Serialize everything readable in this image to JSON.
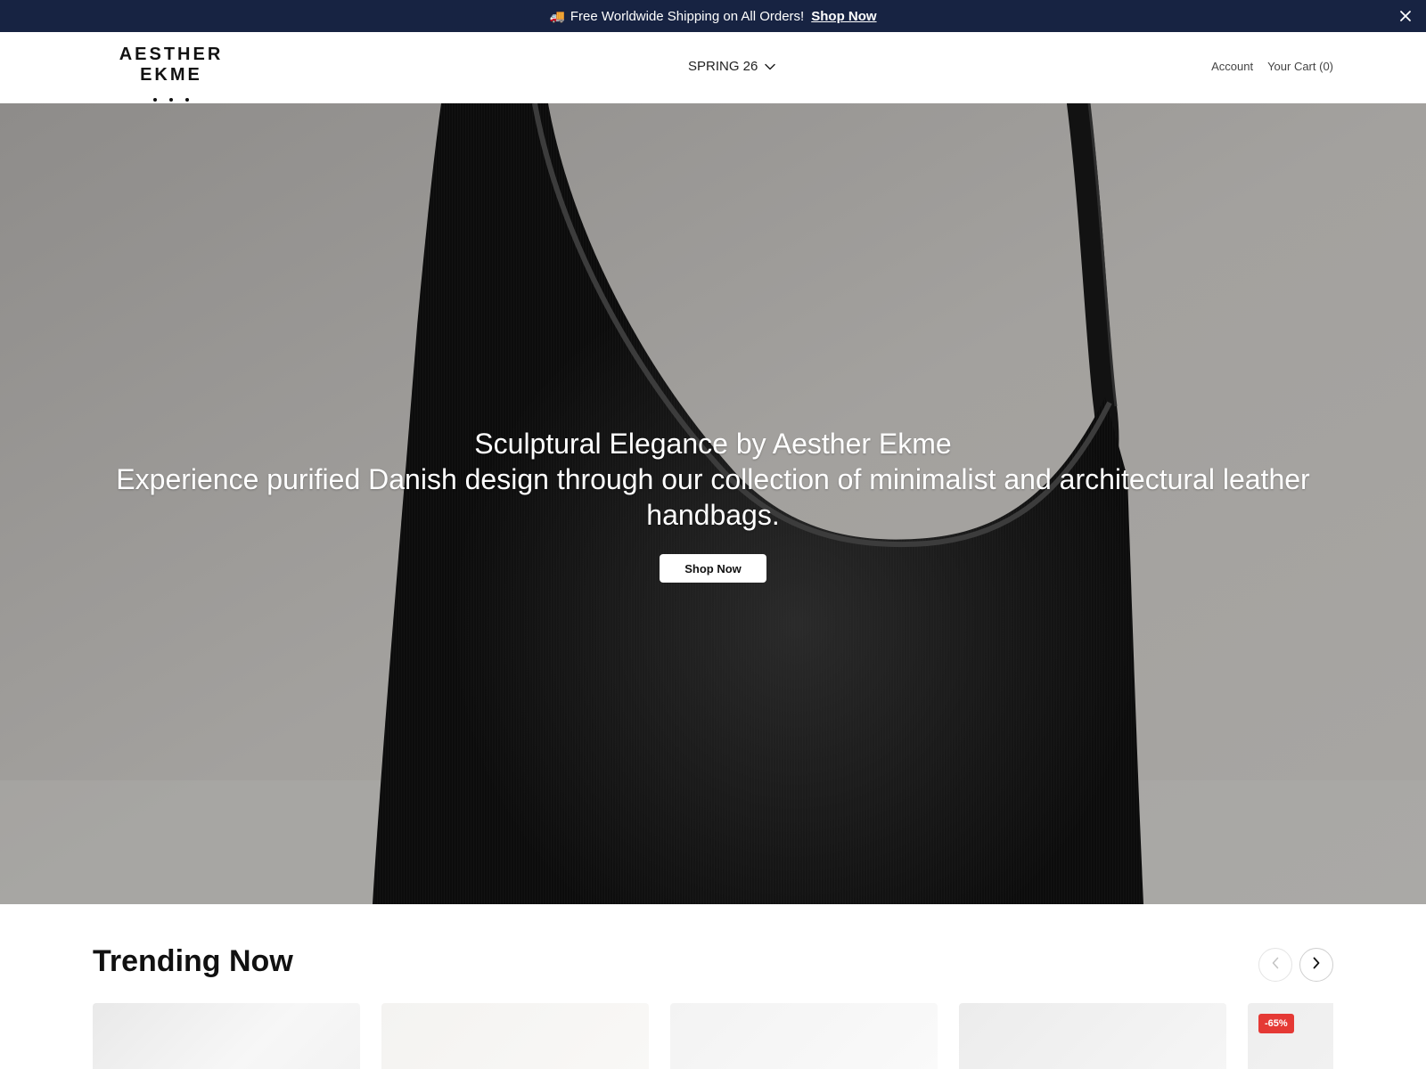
{
  "announcement": {
    "text": "Free Worldwide Shipping on All Orders!",
    "link_label": "Shop Now",
    "icon": "truck-icon"
  },
  "header": {
    "logo": "AESTHER EKME",
    "nav_label": "SPRING 26",
    "account_label": "Account",
    "cart_label": "Your Cart (0)"
  },
  "hero": {
    "headline": "Sculptural Elegance by Aesther Ekme",
    "subheadline": "Experience purified Danish design through our collection of minimalist and architectural leather handbags.",
    "cta_label": "Shop Now"
  },
  "trending": {
    "title": "Trending Now",
    "prev_icon": "chevron-left-icon",
    "next_icon": "chevron-right-icon",
    "cards": [
      {
        "badge": ""
      },
      {
        "badge": ""
      },
      {
        "badge": ""
      },
      {
        "badge": ""
      },
      {
        "badge": "-65%"
      }
    ]
  },
  "colors": {
    "announcement_bg": "#172342",
    "sale_badge": "#e53935"
  }
}
